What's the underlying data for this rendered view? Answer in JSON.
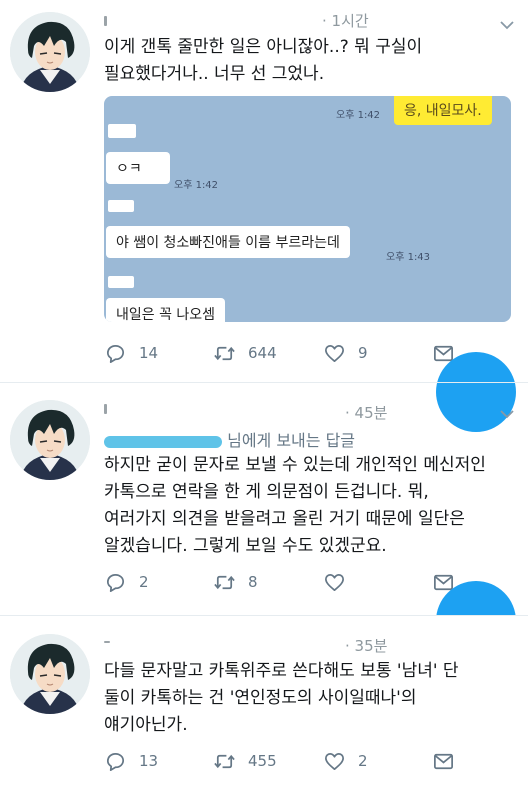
{
  "tweets": [
    {
      "time": "1시간",
      "text_lines": [
        "이게 갠톡 줄만한 일은 아니잖아..? 뭐 구실이",
        "필요했다거나.. 너무 선 그었나."
      ],
      "chat": {
        "sent_bubble": "응, 내일모사.",
        "sent_time": "오후 1:42",
        "msg1": "ㅇㅋ",
        "msg1_time": "오후 1:42",
        "msg2": "야 쌤이 청소빠진애들 이름 부르라는데",
        "msg2_time": "오후 1:43",
        "msg3": "내일은 꼭 나오셈"
      },
      "replies": "14",
      "retweets": "644",
      "likes": "9"
    },
    {
      "time": "45분",
      "reply_to": "님에게 보내는 답글",
      "text_lines": [
        "하지만 굳이 문자로 보낼 수 있는데 개인적인 메신저인",
        "카톡으로 연락을 한 게 의문점이 든겁니다. 뭐,",
        "여러가지 의견을 받을려고 올린 거기 때문에 일단은",
        "알겠습니다. 그렇게 보일 수도 있겠군요."
      ],
      "replies": "2",
      "retweets": "8",
      "likes": ""
    },
    {
      "time": "35분",
      "text_lines": [
        "다들 문자말고 카톡위주로 쓴다해도 보통 '남녀' 단",
        "둘이 카톡하는 건 '연인정도의 사이일때나'의",
        "얘기아닌가."
      ],
      "replies": "13",
      "retweets": "455",
      "likes": "2"
    }
  ],
  "icons": {
    "reply": "reply-icon",
    "retweet": "retweet-icon",
    "like": "heart-icon",
    "message": "envelope-icon",
    "more": "chevron-down-icon"
  },
  "colors": {
    "accent": "#1da1f2",
    "meta_gray": "#657786",
    "chat_bg": "#9bb9d6",
    "chat_bubble_yellow": "#ffeb33"
  }
}
